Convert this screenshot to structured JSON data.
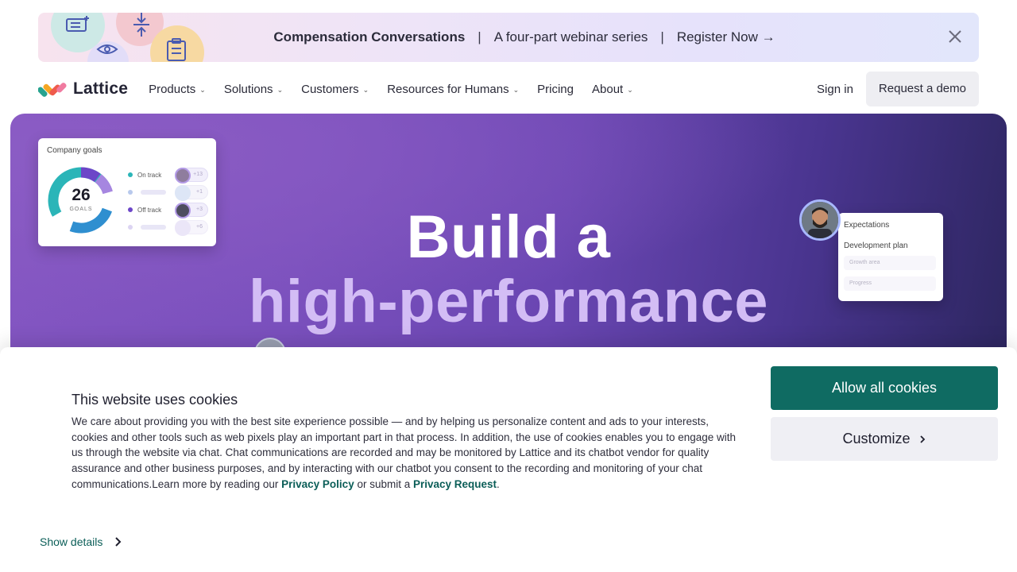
{
  "banner": {
    "title": "Compensation Conversations",
    "separator": "|",
    "subtitle": "A four-part webinar series",
    "cta": "Register Now →",
    "close_icon": "close-icon",
    "icons": [
      "document-plus-icon",
      "eye-icon",
      "compress-arrows-icon",
      "clipboard-icon"
    ]
  },
  "nav": {
    "logo_text": "Lattice",
    "items": [
      {
        "label": "Products",
        "dropdown": true
      },
      {
        "label": "Solutions",
        "dropdown": true
      },
      {
        "label": "Customers",
        "dropdown": true
      },
      {
        "label": "Resources for Humans",
        "dropdown": true
      },
      {
        "label": "Pricing",
        "dropdown": false
      },
      {
        "label": "About",
        "dropdown": true
      }
    ],
    "chevron": "⌄",
    "sign_in": "Sign in",
    "request_demo": "Request a demo"
  },
  "hero": {
    "headline_line1": "Build a",
    "headline_line2": "high-performance",
    "goals_card": {
      "title": "Company goals",
      "count": "26",
      "count_label": "GOALS",
      "legend": [
        {
          "label": "On track",
          "color": "#2bb5b8",
          "extra": "+13"
        },
        {
          "label": "",
          "color": "#b8c9ec",
          "extra": "+1"
        },
        {
          "label": "Off track",
          "color": "#6c46c8",
          "extra": "+3"
        },
        {
          "label": "",
          "color": "#dcd4f2",
          "extra": "+6"
        }
      ]
    },
    "expectations_card": {
      "title": "Expectations",
      "subtitle": "Development plan",
      "fields": [
        "Growth area",
        "Progress"
      ]
    }
  },
  "cookie_banner": {
    "title": "This website uses cookies",
    "body": "We care about providing you with the best site experience possible — and by helping us personalize content and ads to your interests, cookies and other tools such as web pixels play an important part in that process. In addition, the use of cookies enables you to engage with us through the website via chat. Chat communications are recorded and may be monitored by Lattice and its chatbot vendor for quality assurance and other business purposes, and by interacting with our chatbot you consent to the recording and monitoring of your chat communications.Learn more by reading our ",
    "privacy_policy": "Privacy Policy",
    "connector": " or submit a ",
    "privacy_request": "Privacy Request",
    "end": ".",
    "allow_all": "Allow all cookies",
    "customize": "Customize",
    "customize_icon": "chevron-right-icon",
    "show_details": "Show details",
    "show_details_icon": "chevron-right-icon"
  },
  "colors": {
    "accent_green": "#0f6b62",
    "hero_purple": "#7a50bd",
    "hero_highlight": "#d3bdf5"
  }
}
